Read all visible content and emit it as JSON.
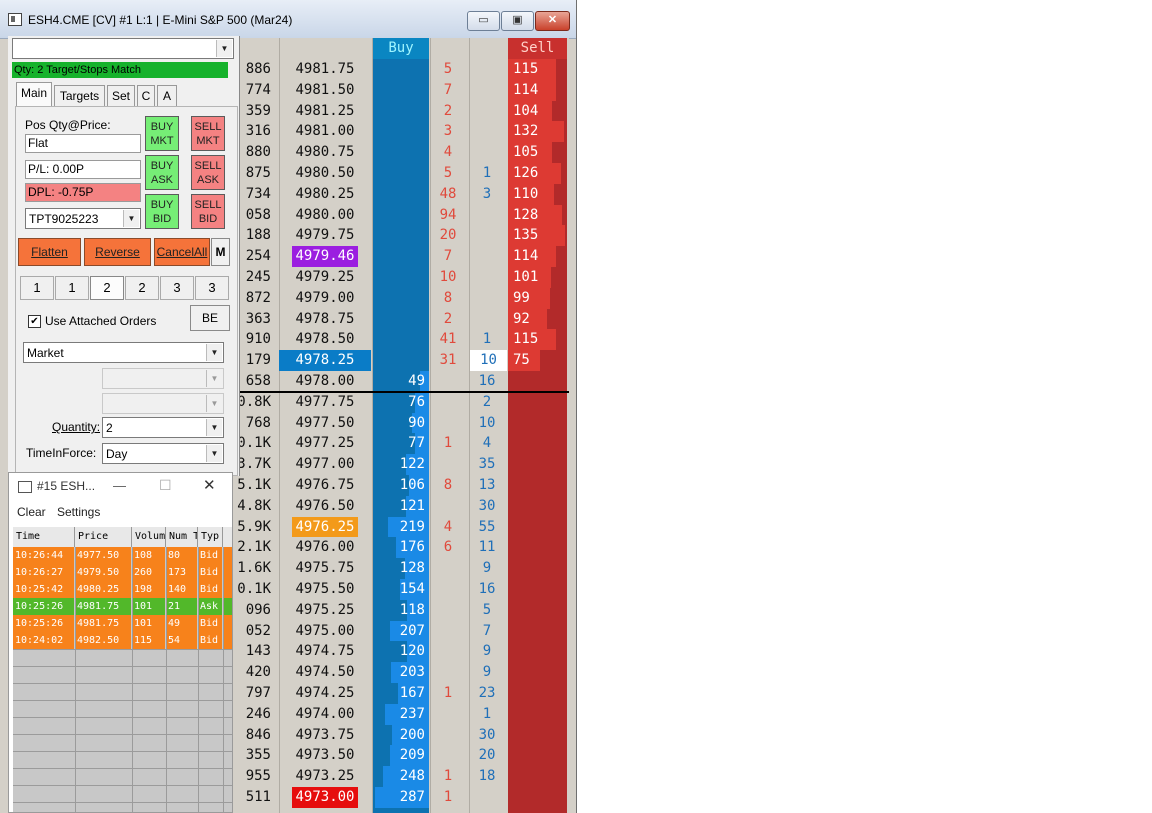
{
  "window": {
    "title": "ESH4.CME [CV] #1 L:1 | E-Mini S&P 500 (Mar24)",
    "min_glyph": "▭",
    "max_glyph": "▣",
    "close_glyph": "✕"
  },
  "dom": {
    "buy_header": "Buy",
    "sell_header": "Sell",
    "rows": [
      {
        "vol": "886",
        "price": "4981.75",
        "bb": "5",
        "sb": "",
        "sell": "115",
        "buy": ""
      },
      {
        "vol": "774",
        "price": "4981.50",
        "bb": "7",
        "sb": "",
        "sell": "114",
        "buy": ""
      },
      {
        "vol": "359",
        "price": "4981.25",
        "bb": "2",
        "sb": "",
        "sell": "104",
        "buy": ""
      },
      {
        "vol": "316",
        "price": "4981.00",
        "bb": "3",
        "sb": "",
        "sell": "132",
        "buy": ""
      },
      {
        "vol": "880",
        "price": "4980.75",
        "bb": "4",
        "sb": "",
        "sell": "105",
        "buy": ""
      },
      {
        "vol": "875",
        "price": "4980.50",
        "bb": "5",
        "sb": "1",
        "sell": "126",
        "buy": ""
      },
      {
        "vol": "734",
        "price": "4980.25",
        "bb": "48",
        "sb": "3",
        "sell": "110",
        "buy": ""
      },
      {
        "vol": "058",
        "price": "4980.00",
        "bb": "94",
        "sb": "",
        "sell": "128",
        "buy": ""
      },
      {
        "vol": "188",
        "price": "4979.75",
        "bb": "20",
        "sb": "",
        "sell": "135",
        "buy": ""
      },
      {
        "vol": "254",
        "price": "4979.46",
        "bb": "7",
        "sb": "",
        "sell": "114",
        "buy": "",
        "hl": "purple"
      },
      {
        "vol": "245",
        "price": "4979.25",
        "bb": "10",
        "sb": "",
        "sell": "101",
        "buy": ""
      },
      {
        "vol": "872",
        "price": "4979.00",
        "bb": "8",
        "sb": "",
        "sell": "99",
        "buy": ""
      },
      {
        "vol": "363",
        "price": "4978.75",
        "bb": "2",
        "sb": "",
        "sell": "92",
        "buy": ""
      },
      {
        "vol": "910",
        "price": "4978.50",
        "bb": "41",
        "sb": "1",
        "sell": "115",
        "buy": ""
      },
      {
        "vol": "179",
        "price": "4978.25",
        "bb": "31",
        "sb": "10",
        "sell": "75",
        "buy": "",
        "hl": "blue",
        "sbhl": true
      },
      {
        "vol": "658",
        "price": "4978.00",
        "bb": "",
        "sb": "16",
        "sell": "",
        "buy": "49"
      },
      {
        "vol": "0.8K",
        "price": "4977.75",
        "bb": "",
        "sb": "2",
        "sell": "",
        "buy": "76"
      },
      {
        "vol": "768",
        "price": "4977.50",
        "bb": "",
        "sb": "10",
        "sell": "",
        "buy": "90"
      },
      {
        "vol": "0.1K",
        "price": "4977.25",
        "bb": "1",
        "sb": "4",
        "sell": "",
        "buy": "77"
      },
      {
        "vol": "3.7K",
        "price": "4977.00",
        "bb": "",
        "sb": "35",
        "sell": "",
        "buy": "122"
      },
      {
        "vol": "5.1K",
        "price": "4976.75",
        "bb": "8",
        "sb": "13",
        "sell": "",
        "buy": "106"
      },
      {
        "vol": "4.8K",
        "price": "4976.50",
        "bb": "",
        "sb": "30",
        "sell": "",
        "buy": "121"
      },
      {
        "vol": "5.9K",
        "price": "4976.25",
        "bb": "4",
        "sb": "55",
        "sell": "",
        "buy": "219",
        "hl": "orange"
      },
      {
        "vol": "2.1K",
        "price": "4976.00",
        "bb": "6",
        "sb": "11",
        "sell": "",
        "buy": "176"
      },
      {
        "vol": "1.6K",
        "price": "4975.75",
        "bb": "",
        "sb": "9",
        "sell": "",
        "buy": "128"
      },
      {
        "vol": "0.1K",
        "price": "4975.50",
        "bb": "",
        "sb": "16",
        "sell": "",
        "buy": "154"
      },
      {
        "vol": "096",
        "price": "4975.25",
        "bb": "",
        "sb": "5",
        "sell": "",
        "buy": "118"
      },
      {
        "vol": "052",
        "price": "4975.00",
        "bb": "",
        "sb": "7",
        "sell": "",
        "buy": "207"
      },
      {
        "vol": "143",
        "price": "4974.75",
        "bb": "",
        "sb": "9",
        "sell": "",
        "buy": "120"
      },
      {
        "vol": "420",
        "price": "4974.50",
        "bb": "",
        "sb": "9",
        "sell": "",
        "buy": "203"
      },
      {
        "vol": "797",
        "price": "4974.25",
        "bb": "1",
        "sb": "23",
        "sell": "",
        "buy": "167"
      },
      {
        "vol": "246",
        "price": "4974.00",
        "bb": "",
        "sb": "1",
        "sell": "",
        "buy": "237"
      },
      {
        "vol": "846",
        "price": "4973.75",
        "bb": "",
        "sb": "30",
        "sell": "",
        "buy": "200"
      },
      {
        "vol": "355",
        "price": "4973.50",
        "bb": "",
        "sb": "20",
        "sell": "",
        "buy": "209"
      },
      {
        "vol": "955",
        "price": "4973.25",
        "bb": "1",
        "sb": "18",
        "sell": "",
        "buy": "248"
      },
      {
        "vol": "511",
        "price": "4973.00",
        "bb": "1",
        "sb": "",
        "sell": "",
        "buy": "287",
        "hl": "red"
      }
    ]
  },
  "panel": {
    "account_combo": "",
    "status": "Qty: 2 Target/Stops Match",
    "tabs": [
      "Main",
      "Targets",
      "Set",
      "C",
      "A"
    ],
    "pos_label": "Pos Qty@Price:",
    "pos_value": "Flat",
    "pl_value": "P/L: 0.00P",
    "dpl_value": "DPL: -0.75P",
    "account": "TPT9025223",
    "buy_mkt": [
      "BUY",
      "MKT"
    ],
    "sell_mkt": [
      "SELL",
      "MKT"
    ],
    "buy_ask": [
      "BUY",
      "ASK"
    ],
    "sell_ask": [
      "SELL",
      "ASK"
    ],
    "buy_bid": [
      "BUY",
      "BID"
    ],
    "sell_bid": [
      "SELL",
      "BID"
    ],
    "flatten": "Flatten",
    "reverse": "Reverse",
    "cancel_all": "CancelAll",
    "m_button": "M",
    "qty_buttons": [
      "1",
      "1",
      "2",
      "2",
      "3",
      "3"
    ],
    "use_attached": "Use Attached Orders",
    "be_button": "BE",
    "order_type": "Market",
    "quantity_label": "Quantity:",
    "quantity_value": "2",
    "tif_label": "TimeInForce:",
    "tif_value": "Day",
    "checkbox_glyph": "✔",
    "arrow_glyph": "▼"
  },
  "time_sales": {
    "title": "#15 ESH...",
    "min_glyph": "—",
    "max_glyph": "☐",
    "close_glyph": "✕",
    "menu": [
      "Clear",
      "Settings"
    ],
    "columns": [
      "Time",
      "Price",
      "Volum",
      "Num T",
      "Typ"
    ],
    "rows": [
      {
        "time": "10:26:44",
        "price": "4977.50",
        "vol": "108",
        "num": "80",
        "type": "Bid",
        "color": "#f7821b"
      },
      {
        "time": "10:26:27",
        "price": "4979.50",
        "vol": "260",
        "num": "173",
        "type": "Bid",
        "color": "#f7821b"
      },
      {
        "time": "10:25:42",
        "price": "4980.25",
        "vol": "198",
        "num": "140",
        "type": "Bid",
        "color": "#f7821b"
      },
      {
        "time": "10:25:26",
        "price": "4981.75",
        "vol": "101",
        "num": "21",
        "type": "Ask",
        "color": "#52b82a"
      },
      {
        "time": "10:25:26",
        "price": "4981.75",
        "vol": "101",
        "num": "49",
        "type": "Bid",
        "color": "#f7821b"
      },
      {
        "time": "10:24:02",
        "price": "4982.50",
        "vol": "115",
        "num": "54",
        "type": "Bid",
        "color": "#f7821b"
      }
    ]
  },
  "colors": {
    "buy_column": "#0d72b0",
    "sell_column": "#b22a2a",
    "status_green": "#16b22c",
    "order_orange": "#f5733a",
    "highlight_purple": "#9b1ee0",
    "highlight_blue": "#0a7cc7",
    "highlight_orange": "#f39a1a",
    "highlight_red": "#e60d0d"
  }
}
